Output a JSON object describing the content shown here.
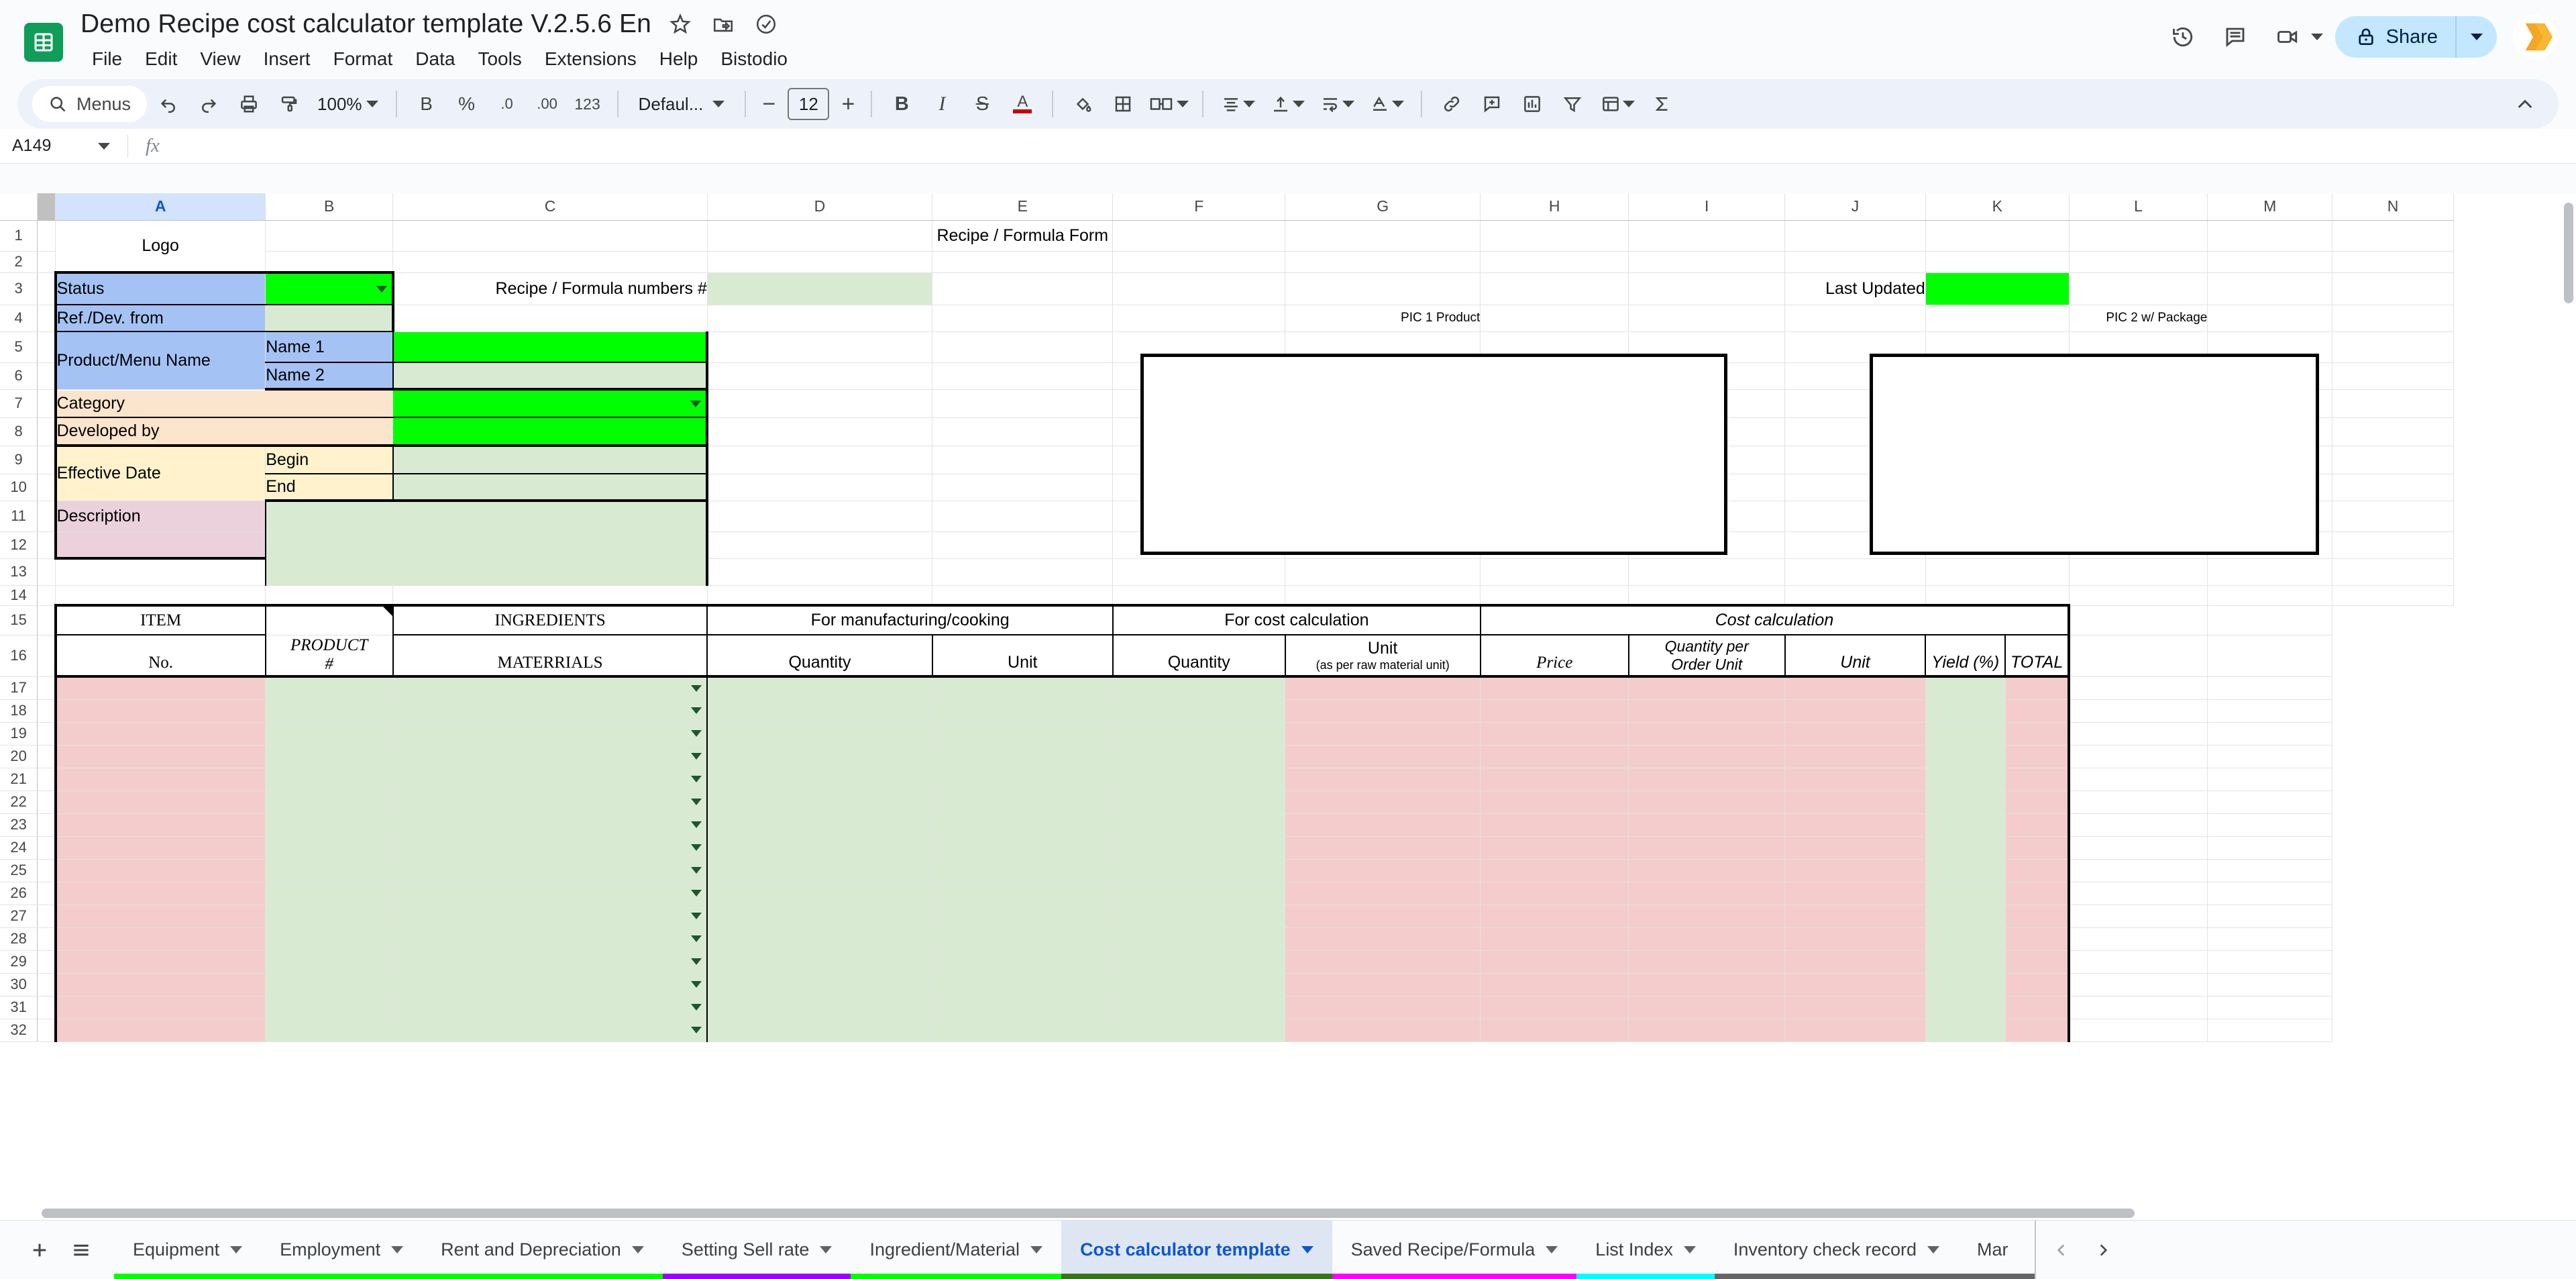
{
  "document": {
    "title": "Demo Recipe cost calculator template V.2.5.6 En",
    "title_icons": [
      "star-icon",
      "move-to-folder-icon",
      "cloud-saved-icon"
    ]
  },
  "menubar": {
    "items": [
      "File",
      "Edit",
      "View",
      "Insert",
      "Format",
      "Data",
      "Tools",
      "Extensions",
      "Help",
      "Bistodio"
    ]
  },
  "top_right": {
    "version_history_icon": "clock-history-icon",
    "comment_icon": "comment-icon",
    "meet_icon": "video-camera-icon",
    "share_label": "Share",
    "avatar_icon": "bistodio-logo"
  },
  "toolbar": {
    "search_label": "Menus",
    "undo_icon": "undo-icon",
    "redo_icon": "redo-icon",
    "print_icon": "print-icon",
    "paint_format_icon": "paint-roller-icon",
    "zoom_value": "100%",
    "currency_label": "B",
    "percent_label": "%",
    "decrease_decimal_label": ".0",
    "increase_decimal_label": ".00",
    "number_format_label": "123",
    "font_family_label": "Defaul...",
    "font_size_minus": "−",
    "font_size_value": "12",
    "font_size_plus": "+",
    "bold_label": "B",
    "italic_label": "I",
    "strikethrough_label": "S",
    "text_color_label": "A",
    "fill_color_icon": "fill-bucket-icon",
    "borders_icon": "borders-icon",
    "merge_icon": "merge-cells-icon",
    "halign_icon": "horizontal-align-icon",
    "valign_icon": "vertical-align-icon",
    "wrap_icon": "text-wrap-icon",
    "rotate_icon": "text-rotation-icon",
    "link_icon": "insert-link-icon",
    "comment_icon": "insert-comment-icon",
    "chart_icon": "insert-chart-icon",
    "filter_icon": "filter-icon",
    "functions_icon": "functions-icon",
    "sigma_icon": "sigma-icon",
    "collapse_icon": "chevron-up-icon"
  },
  "formula_bar": {
    "cell_reference": "A149",
    "fx_label": "fx",
    "formula_value": ""
  },
  "grid": {
    "columns": [
      "A",
      "B",
      "C",
      "D",
      "E",
      "F",
      "G",
      "H",
      "I",
      "J",
      "K",
      "L",
      "M",
      "N"
    ],
    "selected_column": "A",
    "rows": [
      1,
      2,
      3,
      4,
      5,
      6,
      7,
      8,
      9,
      10,
      11,
      12,
      13,
      14,
      15,
      16,
      17,
      18,
      19,
      20,
      21,
      22,
      23,
      24,
      25,
      26,
      27,
      28,
      29,
      30,
      31,
      32
    ],
    "cells": {
      "logo": "Logo",
      "form_title": "Recipe / Formula  Form",
      "status_label": "Status",
      "status_value": "",
      "recipe_numbers_label": "Recipe / Formula numbers #",
      "recipe_numbers_value": "",
      "last_updated_label": "Last Updated",
      "last_updated_value": "",
      "ref_dev_label": "Ref./Dev. from",
      "ref_dev_value": "",
      "product_menu_label": "Product/Menu Name",
      "name1_label": "Name 1",
      "name1_value": "",
      "name2_label": "Name 2",
      "name2_value": "",
      "category_label": "Category",
      "category_value": "",
      "developed_by_label": "Developed by",
      "developed_by_value": "",
      "effective_date_label": "Effective Date",
      "begin_label": "Begin",
      "begin_value": "",
      "end_label": "End",
      "end_value": "",
      "description_label": "Description",
      "description_value": "",
      "pic1_label": "PIC 1 Product",
      "pic2_label": "PIC 2 w/ Package"
    },
    "table_headers": {
      "group_item": "ITEM",
      "group_ingredients": "INGREDIENTS",
      "group_manufacturing": "For manufacturing/cooking",
      "group_cost_calc_input": "For cost calculation",
      "group_cost_calculation": "Cost calculation",
      "col_no": "No.",
      "col_product": "PRODUCT",
      "col_product_hash": "#",
      "col_materials": "MATERRIALS",
      "col_quantity_mfg": "Quantity",
      "col_unit_mfg": "Unit",
      "col_quantity_cost": "Quantity",
      "col_unit_cost": "Unit",
      "col_unit_cost_sub": "(as per raw material unit)",
      "col_price": "Price",
      "col_qty_per_order_unit_l1": "Quantity per",
      "col_qty_per_order_unit_l2": "Order Unit",
      "col_unit_calc": "Unit",
      "col_yield": "Yield (%)",
      "col_total": "TOTAL"
    }
  },
  "sheet_tabs": {
    "add_icon": "plus-icon",
    "all_sheets_icon": "hamburger-menu-icon",
    "prev_icon": "chevron-left-icon",
    "next_icon": "chevron-right-icon",
    "tabs": [
      {
        "label": "Equipment",
        "color": "#00ff00",
        "active": false
      },
      {
        "label": "Employment",
        "color": "#00ff00",
        "active": false
      },
      {
        "label": "Rent and Depreciation",
        "color": "#00ff00",
        "active": false
      },
      {
        "label": "Setting Sell rate",
        "color": "#9900ff",
        "active": false
      },
      {
        "label": "Ingredient/Material",
        "color": "#00ff00",
        "active": false
      },
      {
        "label": "Cost calculator template",
        "color": "#38761d",
        "active": true
      },
      {
        "label": "Saved Recipe/Formula",
        "color": "#ff00ff",
        "active": false
      },
      {
        "label": "List Index",
        "color": "#00ffff",
        "active": false
      },
      {
        "label": "Inventory check record",
        "color": "#666666",
        "active": false
      },
      {
        "label": "Mar",
        "color": "#666666",
        "active": false
      }
    ]
  },
  "colors": {
    "accent": "#0b57d0",
    "brand_green": "#0f9d58",
    "fill_blue": "#a4c2f4",
    "fill_green": "#00ff00",
    "fill_light_green": "#d9ead3",
    "fill_orange": "#fce5cd",
    "fill_yellow": "#fff2cc",
    "fill_pink": "#ead1dc",
    "fill_red": "#f4cccc"
  }
}
